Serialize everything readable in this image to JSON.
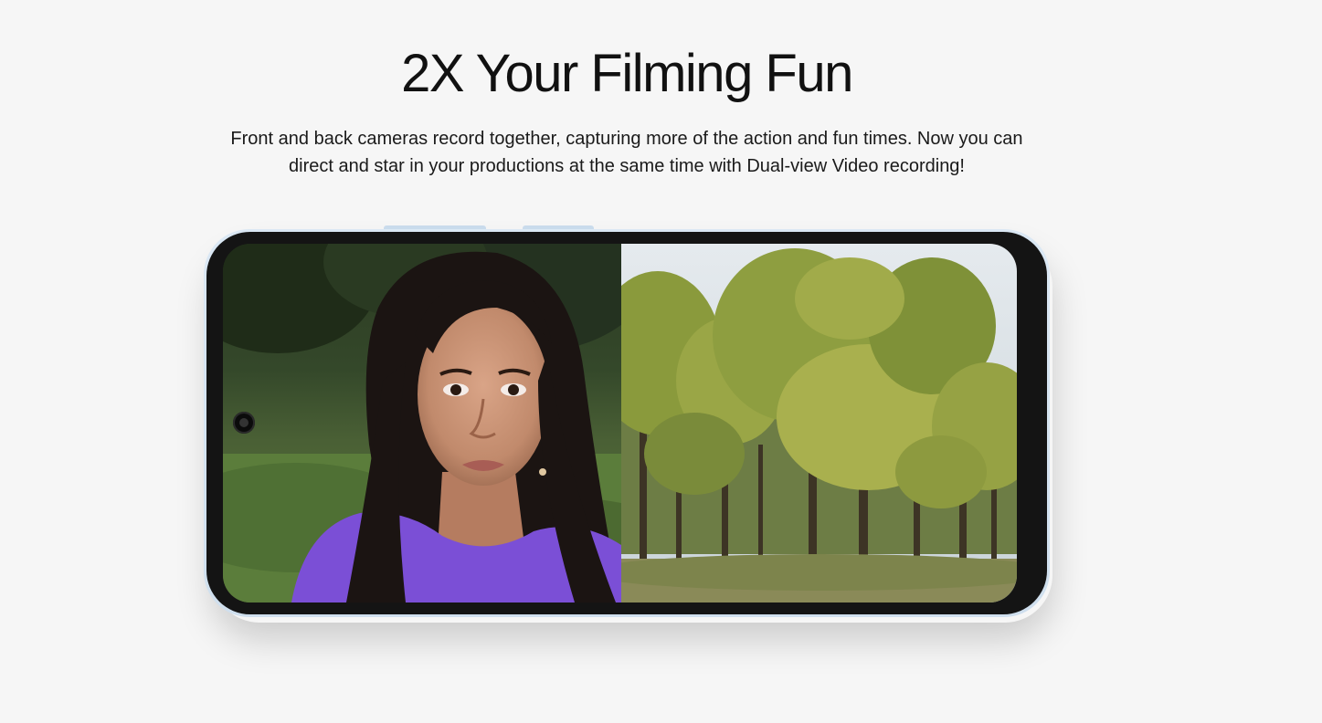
{
  "headline": "2X Your Filming Fun",
  "subtext": "Front and back cameras record together, capturing more of the action and fun times. Now you can direct and star in your productions at the same time with Dual-view Video recording!",
  "phone": {
    "left_view": "front-camera-selfie-view",
    "right_view": "rear-camera-forest-view"
  },
  "colors": {
    "background": "#f6f6f6",
    "phone_frame": "#d6e5f2",
    "bezel": "#141414",
    "shirt": "#7b4fd6"
  }
}
